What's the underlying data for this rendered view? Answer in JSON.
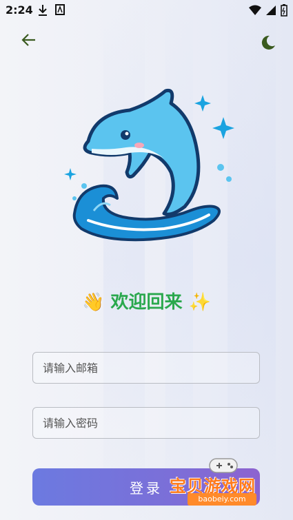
{
  "status_bar": {
    "time": "2:24"
  },
  "hero": {
    "welcome_wave": "👋",
    "welcome_text": "欢迎回来",
    "welcome_sparkle": "✨"
  },
  "form": {
    "email_placeholder": "请输入邮箱",
    "password_placeholder": "请输入密码",
    "login_label": "登录"
  },
  "watermark": {
    "text": "宝贝游戏网",
    "url": "baobeiy.com"
  },
  "colors": {
    "welcome_green": "#2aa84d",
    "accent": "#6c7ae0",
    "icon_dark_green": "#3a5a1f",
    "dolphin_blue": "#5bc4ef"
  }
}
